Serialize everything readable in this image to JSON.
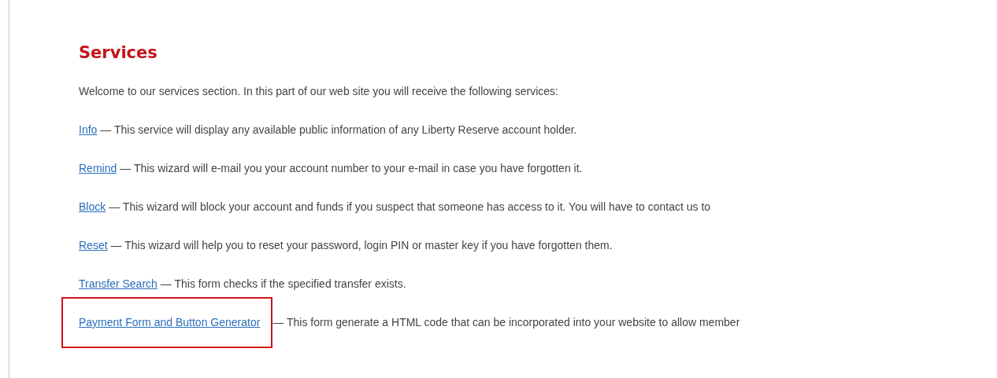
{
  "heading": "Services",
  "intro": "Welcome to our services section. In this part of our web site you will receive the following services:",
  "services": [
    {
      "link": "Info",
      "description": "— This service will display any available public information of any Liberty Reserve account holder.",
      "highlighted": false
    },
    {
      "link": "Remind",
      "description": "— This wizard will e-mail you your account number to your e-mail in case you have forgotten it.",
      "highlighted": false
    },
    {
      "link": "Block",
      "description": "— This wizard will block your account and funds if you suspect that someone has access to it. You will have to contact us to",
      "highlighted": false
    },
    {
      "link": "Reset",
      "description": "— This wizard will help you to reset your password, login PIN or master key if you have forgotten them.",
      "highlighted": false
    },
    {
      "link": "Transfer Search",
      "description": "— This form checks if the specified transfer exists.",
      "highlighted": false
    },
    {
      "link": "Payment Form and Button Generator",
      "description": "— This form generate a HTML code that can be incorporated into your website to allow member",
      "highlighted": true
    }
  ]
}
